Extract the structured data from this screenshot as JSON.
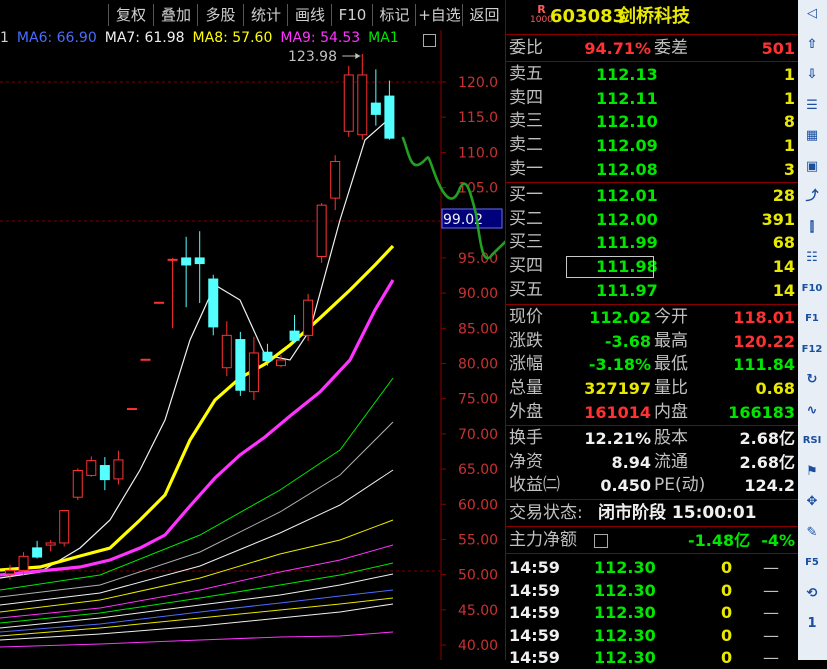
{
  "toolbar": {
    "buttons": [
      "复权",
      "叠加",
      "多股",
      "统计",
      "画线",
      "F10",
      "标记",
      "+自选",
      "返回"
    ]
  },
  "ma_legend": [
    {
      "label": "1",
      "color": "#d0d0d0"
    },
    {
      "label": "MA6: 66.90",
      "color": "#4a6cff"
    },
    {
      "label": "MA7: 61.98",
      "color": "#f0f0f0"
    },
    {
      "label": "MA8: 57.60",
      "color": "#ffff00"
    },
    {
      "label": "MA9: 54.53",
      "color": "#ff33ff"
    },
    {
      "label": "MA1",
      "color": "#00e600"
    }
  ],
  "chart": {
    "y_labels": [
      "120.0",
      "115.0",
      "110.0",
      "105.0",
      "100.0",
      "95.00",
      "90.00",
      "85.00",
      "80.00",
      "75.00",
      "70.00",
      "65.00",
      "60.00",
      "55.00",
      "50.00",
      "45.00",
      "40.00"
    ],
    "max_label": "123.98",
    "cursor_label": "99.02"
  },
  "chart_data": {
    "type": "candlestick",
    "ylim": [
      38.4,
      124
    ],
    "candles": [
      {
        "o": 50.1,
        "h": 51.4,
        "l": 49.3,
        "c": 50.6,
        "up": true
      },
      {
        "o": 50.6,
        "h": 53.2,
        "l": 49.9,
        "c": 52.6,
        "up": true
      },
      {
        "o": 53.8,
        "h": 54.8,
        "l": 52.3,
        "c": 52.5,
        "up": false
      },
      {
        "o": 54.2,
        "h": 54.9,
        "l": 53.3,
        "c": 54.5,
        "up": true
      },
      {
        "o": 54.5,
        "h": 59.2,
        "l": 54.0,
        "c": 59.1,
        "up": true
      },
      {
        "o": 61.0,
        "h": 65.1,
        "l": 60.6,
        "c": 64.8,
        "up": true
      },
      {
        "o": 64.1,
        "h": 66.8,
        "l": 63.9,
        "c": 66.2,
        "up": true
      },
      {
        "o": 65.5,
        "h": 66.7,
        "l": 62.0,
        "c": 63.5,
        "up": false
      },
      {
        "o": 63.6,
        "h": 67.6,
        "l": 62.8,
        "c": 66.3,
        "up": true
      },
      {
        "o": 73.6,
        "h": 73.6,
        "l": 73.6,
        "c": 73.6,
        "up": true
      },
      {
        "o": 80.6,
        "h": 80.6,
        "l": 80.6,
        "c": 80.6,
        "up": true
      },
      {
        "o": 88.7,
        "h": 88.7,
        "l": 88.7,
        "c": 88.7,
        "up": true
      },
      {
        "o": 94.8,
        "h": 95.0,
        "l": 85.0,
        "c": 94.8,
        "up": true
      },
      {
        "o": 95.0,
        "h": 98.0,
        "l": 88.0,
        "c": 94.0,
        "up": false
      },
      {
        "o": 95.0,
        "h": 98.8,
        "l": 88.6,
        "c": 94.2,
        "up": false
      },
      {
        "o": 92.0,
        "h": 92.6,
        "l": 84.0,
        "c": 85.2,
        "up": false
      },
      {
        "o": 84.0,
        "h": 86.0,
        "l": 78.2,
        "c": 79.4,
        "up": true
      },
      {
        "o": 83.4,
        "h": 84.5,
        "l": 75.4,
        "c": 76.2,
        "up": false
      },
      {
        "o": 76.0,
        "h": 83.8,
        "l": 74.8,
        "c": 81.5,
        "up": true
      },
      {
        "o": 81.6,
        "h": 82.8,
        "l": 79.7,
        "c": 80.4,
        "up": false
      },
      {
        "o": 79.7,
        "h": 81.2,
        "l": 79.5,
        "c": 80.5,
        "up": true
      },
      {
        "o": 84.6,
        "h": 86.9,
        "l": 82.9,
        "c": 83.3,
        "up": false
      },
      {
        "o": 84.0,
        "h": 89.9,
        "l": 83.2,
        "c": 89.0,
        "up": true
      },
      {
        "o": 95.2,
        "h": 102.8,
        "l": 94.3,
        "c": 102.5,
        "up": true
      },
      {
        "o": 103.5,
        "h": 109.6,
        "l": 101.8,
        "c": 108.7,
        "up": true
      },
      {
        "o": 113.0,
        "h": 122.3,
        "l": 112.2,
        "c": 121.0,
        "up": true
      },
      {
        "o": 112.5,
        "h": 123.98,
        "l": 111.8,
        "c": 121.0,
        "up": true
      },
      {
        "o": 117.0,
        "h": 121.8,
        "l": 113.8,
        "c": 115.4,
        "up": false
      },
      {
        "o": 118.0,
        "h": 120.2,
        "l": 111.8,
        "c": 112.02,
        "up": false
      }
    ]
  },
  "quote": {
    "code": "603083",
    "name": "剑桥科技",
    "badge_top": "R",
    "badge_bottom": "1000",
    "weibi_label": "委比",
    "weibi_value": "94.71%",
    "weicha_label": "委差",
    "weicha_value": "501",
    "sells": [
      {
        "label": "卖五",
        "price": "112.13",
        "vol": "1"
      },
      {
        "label": "卖四",
        "price": "112.11",
        "vol": "1"
      },
      {
        "label": "卖三",
        "price": "112.10",
        "vol": "8"
      },
      {
        "label": "卖二",
        "price": "112.09",
        "vol": "1"
      },
      {
        "label": "卖一",
        "price": "112.08",
        "vol": "3"
      }
    ],
    "buys": [
      {
        "label": "买一",
        "price": "112.01",
        "vol": "28"
      },
      {
        "label": "买二",
        "price": "112.00",
        "vol": "391"
      },
      {
        "label": "买三",
        "price": "111.99",
        "vol": "68"
      },
      {
        "label": "买四",
        "price": "111.98",
        "vol": "14"
      },
      {
        "label": "买五",
        "price": "111.97",
        "vol": "14"
      }
    ],
    "stats": [
      {
        "l1": "现价",
        "v1": "112.02",
        "c1": "green",
        "l2": "今开",
        "v2": "118.01",
        "c2": "red"
      },
      {
        "l1": "涨跌",
        "v1": "-3.68",
        "c1": "green",
        "l2": "最高",
        "v2": "120.22",
        "c2": "red"
      },
      {
        "l1": "涨幅",
        "v1": "-3.18%",
        "c1": "green",
        "l2": "最低",
        "v2": "111.84",
        "c2": "green"
      },
      {
        "l1": "总量",
        "v1": "327197",
        "c1": "yellow",
        "l2": "量比",
        "v2": "0.68",
        "c2": "yellow"
      },
      {
        "l1": "外盘",
        "v1": "161014",
        "c1": "red",
        "l2": "内盘",
        "v2": "166183",
        "c2": "green"
      }
    ],
    "fund": [
      {
        "l1": "换手",
        "v1": "12.21%",
        "l2": "股本",
        "v2": "2.68亿"
      },
      {
        "l1": "净资",
        "v1": "8.94",
        "l2": "流通",
        "v2": "2.68亿"
      },
      {
        "l1": "收益㈡",
        "v1": "0.450",
        "l2": "PE(动)",
        "v2": "124.2"
      }
    ],
    "trade_status_label": "交易状态:",
    "trade_status_value": "闭市阶段 15:00:01",
    "main_flow_label": "主力净额",
    "main_flow_value": "-1.48亿",
    "main_flow_pct": "-4%",
    "ticks": [
      {
        "time": "14:59",
        "price": "112.30",
        "vol": "0",
        "mark": "—"
      },
      {
        "time": "14:59",
        "price": "112.30",
        "vol": "0",
        "mark": "—"
      },
      {
        "time": "14:59",
        "price": "112.30",
        "vol": "0",
        "mark": "—"
      },
      {
        "time": "14:59",
        "price": "112.30",
        "vol": "0",
        "mark": "—"
      },
      {
        "time": "14:59",
        "price": "112.30",
        "vol": "0",
        "mark": "—"
      }
    ]
  },
  "side_toolbar": {
    "icons": [
      "arrow-left-icon",
      "arrow-up-icon",
      "arrow-down-icon",
      "list-icon",
      "bars-icon",
      "grid-icon",
      "line-chart-icon",
      "candle-icon",
      "doc-icon",
      "f10-icon",
      "f1-icon",
      "f12-icon",
      "refresh-icon",
      "wave-icon",
      "rsi-icon",
      "flag-icon",
      "move-icon",
      "pencil-icon",
      "f5-icon",
      "cycle-icon",
      "one-icon"
    ],
    "labels": [
      "◁",
      "⇧",
      "⇩",
      "☰",
      "▦",
      "▣",
      "⤴",
      "⫿",
      "☷",
      "F10",
      "F1",
      "F12",
      "↻",
      "∿",
      "RSI",
      "⚑",
      "✥",
      "✎",
      "F5",
      "⟲",
      "1"
    ]
  }
}
